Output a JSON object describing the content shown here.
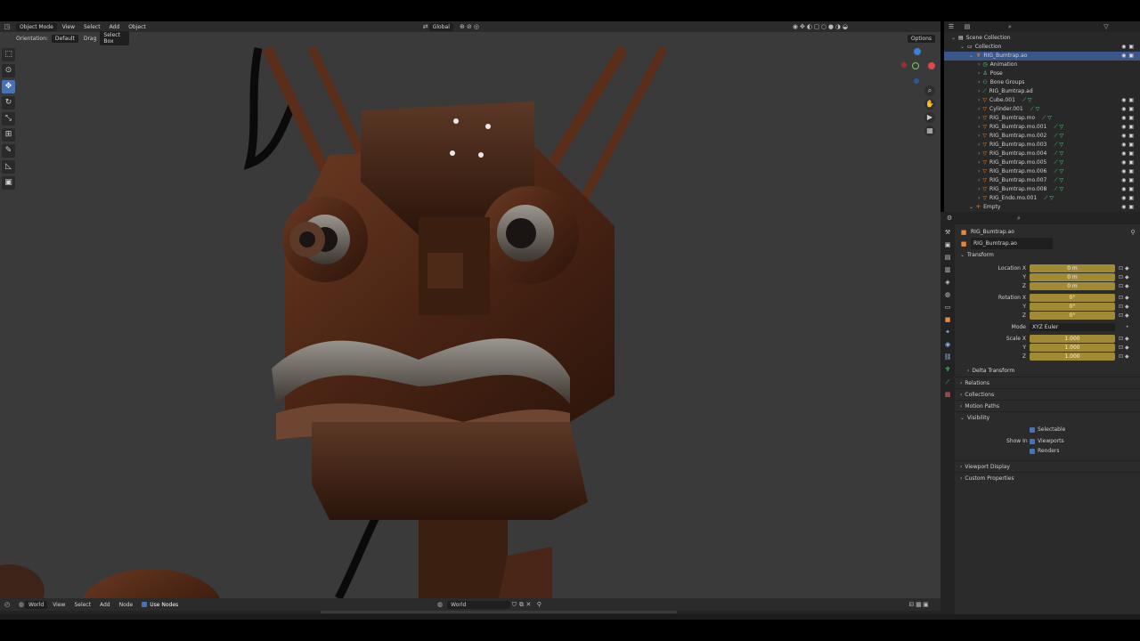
{
  "viewport": {
    "header": {
      "mode": "Object Mode",
      "menus": [
        "View",
        "Select",
        "Add",
        "Object"
      ],
      "transform_orientation": "Global",
      "options_label": "Options"
    },
    "subheader": {
      "orientation_label": "Orientation:",
      "orientation_value": "Default",
      "drag_label": "Drag",
      "drag_value": "Select Box"
    },
    "tools": [
      "select-box-tool",
      "cursor-tool",
      "move-tool",
      "rotate-tool",
      "scale-tool",
      "transform-tool",
      "annotate-tool",
      "measure-tool",
      "add-cube-tool"
    ]
  },
  "outliner": {
    "rows": [
      {
        "label": "Scene Collection",
        "indent": 0,
        "icon": "scene-collection-icon"
      },
      {
        "label": "Collection",
        "indent": 1,
        "icon": "collection-icon"
      },
      {
        "label": "RIG_Bumtrap.ao",
        "indent": 2,
        "icon": "armature-icon",
        "selected": true
      },
      {
        "label": "Animation",
        "indent": 3,
        "icon": "animation-icon"
      },
      {
        "label": "Pose",
        "indent": 3,
        "icon": "pose-icon"
      },
      {
        "label": "Bone Groups",
        "indent": 3,
        "icon": "bone-groups-icon"
      },
      {
        "label": "RIG_Bumtrap.ad",
        "indent": 3,
        "icon": "armature-data-icon"
      },
      {
        "label": "Cube.001",
        "indent": 3,
        "icon": "mesh-icon"
      },
      {
        "label": "Cylinder.001",
        "indent": 3,
        "icon": "mesh-icon"
      },
      {
        "label": "RIG_Bumtrap.mo",
        "indent": 3,
        "icon": "mesh-icon"
      },
      {
        "label": "RIG_Bumtrap.mo.001",
        "indent": 3,
        "icon": "mesh-icon"
      },
      {
        "label": "RIG_Bumtrap.mo.002",
        "indent": 3,
        "icon": "mesh-icon"
      },
      {
        "label": "RIG_Bumtrap.mo.003",
        "indent": 3,
        "icon": "mesh-icon"
      },
      {
        "label": "RIG_Bumtrap.mo.004",
        "indent": 3,
        "icon": "mesh-icon"
      },
      {
        "label": "RIG_Bumtrap.mo.005",
        "indent": 3,
        "icon": "mesh-icon"
      },
      {
        "label": "RIG_Bumtrap.mo.006",
        "indent": 3,
        "icon": "mesh-icon"
      },
      {
        "label": "RIG_Bumtrap.mo.007",
        "indent": 3,
        "icon": "mesh-icon"
      },
      {
        "label": "RIG_Bumtrap.mo.008",
        "indent": 3,
        "icon": "mesh-icon"
      },
      {
        "label": "RIG_Endo.mo.001",
        "indent": 3,
        "icon": "mesh-icon"
      },
      {
        "label": "Empty",
        "indent": 2,
        "icon": "empty-icon"
      }
    ]
  },
  "properties": {
    "object_name": "RIG_Bumtrap.ao",
    "object_field": "RIG_Bumtrap.ao",
    "transform": {
      "title": "Transform",
      "location_label": "Location X",
      "location": [
        "0 m",
        "0 m",
        "0 m"
      ],
      "rotation_label": "Rotation X",
      "rotation": [
        "0°",
        "0°",
        "0°"
      ],
      "mode_label": "Mode",
      "mode_value": "XYZ Euler",
      "scale_label": "Scale X",
      "scale": [
        "1.000",
        "1.000",
        "1.000"
      ],
      "axis_y": "Y",
      "axis_z": "Z",
      "delta": "Delta Transform"
    },
    "panels_collapsed_1": [
      "Relations",
      "Collections",
      "Motion Paths"
    ],
    "visibility": {
      "title": "Visibility",
      "selectable": "Selectable",
      "show_in": "Show In",
      "viewports": "Viewports",
      "renders": "Renders"
    },
    "panels_collapsed_2": [
      "Viewport Display",
      "Custom Properties"
    ]
  },
  "node_editor": {
    "world_dropdown": "World",
    "menus": [
      "View",
      "Select",
      "Add",
      "Node"
    ],
    "use_nodes": "Use Nodes",
    "world_field": "World"
  }
}
